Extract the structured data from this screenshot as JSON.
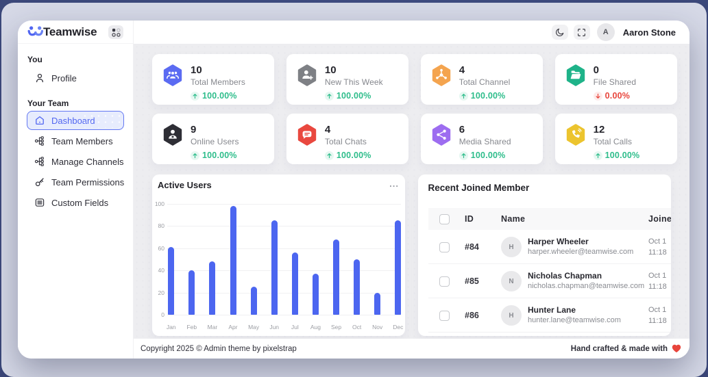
{
  "brand": {
    "name": "Teamwise"
  },
  "header": {
    "actions": [
      {
        "icon": "moon-icon"
      },
      {
        "icon": "fullscreen-icon"
      }
    ],
    "user_initial": "A",
    "user_name": "Aaron Stone"
  },
  "sidebar": {
    "sections": [
      {
        "label": "You",
        "items": [
          {
            "label": "Profile",
            "icon": "user-icon",
            "active": false
          }
        ]
      },
      {
        "label": "Your Team",
        "items": [
          {
            "label": "Dashboard",
            "icon": "home-icon",
            "active": true
          },
          {
            "label": "Team Members",
            "icon": "org-tree-icon",
            "active": false
          },
          {
            "label": "Manage Channels",
            "icon": "org-tree-icon",
            "active": false
          },
          {
            "label": "Team Permissions",
            "icon": "key-icon",
            "active": false
          },
          {
            "label": "Custom Fields",
            "icon": "list-icon",
            "active": false
          }
        ]
      }
    ]
  },
  "stats": [
    {
      "icon": "users-icon",
      "color": "#5b6bf2",
      "value": "10",
      "label": "Total Members",
      "delta": "100.00%",
      "direction": "up"
    },
    {
      "icon": "user-plus-icon",
      "color": "#7e8085",
      "value": "10",
      "label": "New This Week",
      "delta": "100.00%",
      "direction": "up"
    },
    {
      "icon": "network-icon",
      "color": "#f4a44f",
      "value": "4",
      "label": "Total Channel",
      "delta": "100.00%",
      "direction": "up"
    },
    {
      "icon": "folder-icon",
      "color": "#1fb389",
      "value": "0",
      "label": "File Shared",
      "delta": "0.00%",
      "direction": "down"
    },
    {
      "icon": "online-user-icon",
      "color": "#2e2e35",
      "value": "9",
      "label": "Online Users",
      "delta": "100.00%",
      "direction": "up"
    },
    {
      "icon": "chat-icon",
      "color": "#e9483f",
      "value": "4",
      "label": "Total Chats",
      "delta": "100.00%",
      "direction": "up"
    },
    {
      "icon": "share-icon",
      "color": "#9d6df0",
      "value": "6",
      "label": "Media Shared",
      "delta": "100.00%",
      "direction": "up"
    },
    {
      "icon": "phone-icon",
      "color": "#ecc42e",
      "value": "12",
      "label": "Total Calls",
      "delta": "100.00%",
      "direction": "up"
    }
  ],
  "chart_data": {
    "type": "bar",
    "title": "Active Users",
    "categories": [
      "Jan",
      "Feb",
      "Mar",
      "Apr",
      "May",
      "Jun",
      "Jul",
      "Aug",
      "Sep",
      "Oct",
      "Nov",
      "Dec"
    ],
    "values": [
      61,
      40,
      48,
      98,
      25,
      85,
      56,
      37,
      68,
      50,
      20,
      85
    ],
    "xlabel": "",
    "ylabel": "",
    "ylim": [
      0,
      100
    ],
    "yticks": [
      0,
      20,
      40,
      60,
      80,
      100
    ],
    "grid": true,
    "legend": false,
    "bar_color": "#4c66f0",
    "menu_icon": "ellipsis-icon"
  },
  "table": {
    "title": "Recent Joined Member",
    "select_all_checkbox": "",
    "columns": [
      "ID",
      "Name",
      "Joined"
    ],
    "rows": [
      {
        "id": "#84",
        "initial": "H",
        "name": "Harper Wheeler",
        "email": "harper.wheeler@teamwise.com",
        "date": "Oct 1",
        "time": "11:18"
      },
      {
        "id": "#85",
        "initial": "N",
        "name": "Nicholas Chapman",
        "email": "nicholas.chapman@teamwise.com",
        "date": "Oct 1",
        "time": "11:18"
      },
      {
        "id": "#86",
        "initial": "H",
        "name": "Hunter Lane",
        "email": "hunter.lane@teamwise.com",
        "date": "Oct 1",
        "time": "11:18"
      }
    ]
  },
  "footer": {
    "copyright": "Copyright 2025 © Admin theme by pixelstrap",
    "tagline": "Hand crafted & made with",
    "heart_icon": "heart-icon"
  },
  "colors": {
    "primary": "#5166f1",
    "success": "#2ebd8b",
    "danger": "#e8453c",
    "frame_outer": "#3a4677",
    "frame_inner": "#d6d9e7",
    "content_bg": "#ededf0"
  }
}
